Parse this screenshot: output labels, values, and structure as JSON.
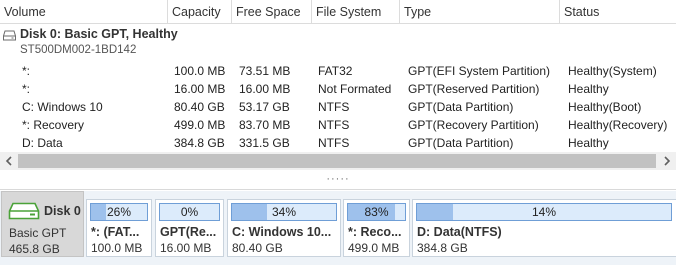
{
  "columns": [
    "Volume",
    "Capacity",
    "Free Space",
    "File System",
    "Type",
    "Status"
  ],
  "disk": {
    "title": "Disk 0: Basic GPT, Healthy",
    "model": "ST500DM002-1BD142"
  },
  "partitions": [
    {
      "volume": "*:",
      "capacity": "100.0 MB",
      "free": "73.51 MB",
      "fs": "FAT32",
      "type": "GPT(EFI System Partition)",
      "status": "Healthy(System)"
    },
    {
      "volume": "*:",
      "capacity": "16.00 MB",
      "free": "16.00 MB",
      "fs": "Not Formated",
      "type": "GPT(Reserved Partition)",
      "status": "Healthy"
    },
    {
      "volume": "C: Windows 10",
      "capacity": "80.40 GB",
      "free": "53.17 GB",
      "fs": "NTFS",
      "type": "GPT(Data Partition)",
      "status": "Healthy(Boot)"
    },
    {
      "volume": "*: Recovery",
      "capacity": "499.0 MB",
      "free": "83.70 MB",
      "fs": "NTFS",
      "type": "GPT(Recovery Partition)",
      "status": "Healthy(Recovery)"
    },
    {
      "volume": "D: Data",
      "capacity": "384.8 GB",
      "free": "331.5 GB",
      "fs": "NTFS",
      "type": "GPT(Data Partition)",
      "status": "Healthy"
    }
  ],
  "splitter_grip": "·····",
  "disk_map": {
    "name": "Disk 0",
    "type": "Basic GPT",
    "size": "465.8 GB",
    "blocks": [
      {
        "usage": 26,
        "usage_label": "26%",
        "name": "*: (FAT...",
        "size": "100.0 MB"
      },
      {
        "usage": 0,
        "usage_label": "0%",
        "name": "GPT(Re...",
        "size": "16.00 MB"
      },
      {
        "usage": 34,
        "usage_label": "34%",
        "name": "C: Windows 10...",
        "size": "80.40 GB"
      },
      {
        "usage": 83,
        "usage_label": "83%",
        "name": "*: Reco...",
        "size": "499.0 MB"
      },
      {
        "usage": 14,
        "usage_label": "14%",
        "name": "D: Data(NTFS)",
        "size": "384.8 GB"
      }
    ]
  },
  "icons": {
    "disk_small": "disk-icon",
    "hdd": "hard-drive-icon",
    "scroll_left": "chevron-left-icon",
    "scroll_right": "chevron-right-icon"
  },
  "colors": {
    "usage_fill": "#9ec1ec",
    "usage_track": "#dcebfb",
    "usage_border": "#6f9ed6",
    "disk_card": "#d8d8d8",
    "map_background": "#eef3f8",
    "scroll_thumb": "#c2c2c2"
  }
}
